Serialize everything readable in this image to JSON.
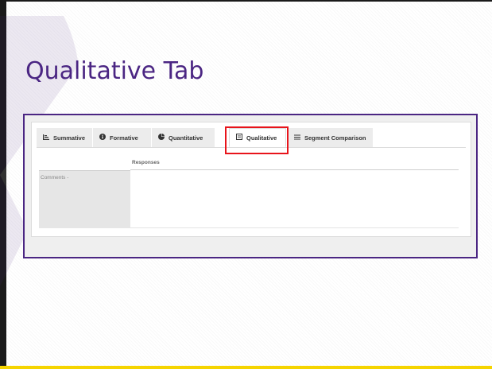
{
  "slide": {
    "title": "Qualitative Tab",
    "accent_color": "#4b2683",
    "footer_color": "#f5d400"
  },
  "tabs": [
    {
      "label": "Summative",
      "icon": "bar-chart-icon",
      "active": false
    },
    {
      "label": "Formative",
      "icon": "info-circle-icon",
      "active": false
    },
    {
      "label": "Quantitative",
      "icon": "pie-chart-icon",
      "active": false
    },
    {
      "label": "Qualitative",
      "icon": "document-icon",
      "active": true
    },
    {
      "label": "Segment Comparison",
      "icon": "list-lines-icon",
      "active": false
    }
  ],
  "highlight_color": "#e8141b",
  "table": {
    "columns": [
      "",
      "Responses"
    ],
    "rows": [
      {
        "label": "Comments -",
        "response": ""
      }
    ]
  }
}
